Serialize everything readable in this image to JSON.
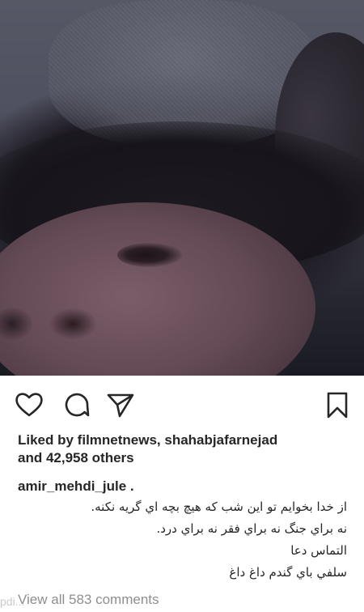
{
  "post": {
    "photo_alt": "selfie photo"
  },
  "actions": {
    "like": "heart-icon",
    "comment": "comment-icon",
    "share": "share-icon",
    "save": "bookmark-icon"
  },
  "likes": {
    "line1": "Liked by filmnetnews, shahabjafarnejad",
    "line2": "and 42,958 others"
  },
  "caption": {
    "username": "amir_mehdi_jule .",
    "lines": [
      "از خدا بخوايم تو اين شب كه هيچ بچه اي گريه نكنه.",
      "نه براي جنگ نه براي فقر نه براي درد.",
      "التماس دعا",
      "سلفي باي گندم داغ داغ"
    ]
  },
  "comments": {
    "view_all": "View all 583 comments"
  },
  "watermark": "pdi..."
}
